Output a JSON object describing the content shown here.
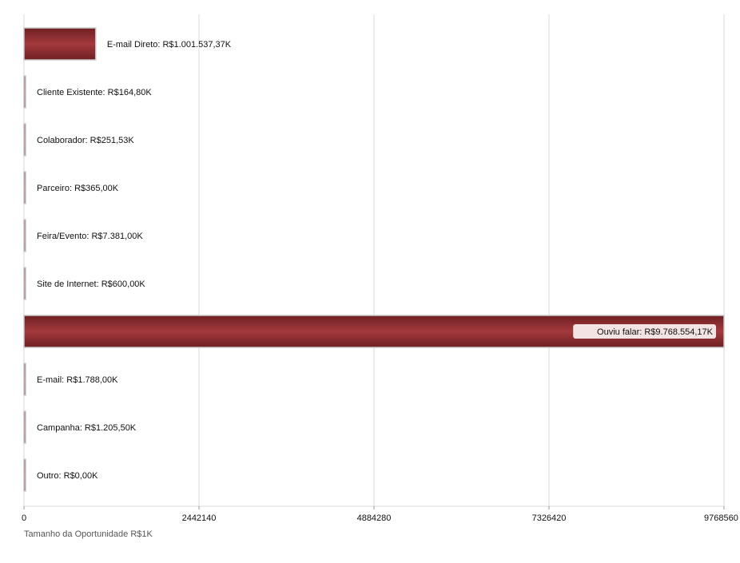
{
  "chart_data": {
    "type": "bar",
    "orientation": "horizontal",
    "categories": [
      "E-mail Direto",
      "Cliente Existente",
      "Colaborador",
      "Parceiro",
      "Feira/Evento",
      "Site de Internet",
      "Ouviu falar",
      "E-mail",
      "Campanha",
      "Outro"
    ],
    "values": [
      1001537.37,
      164.8,
      251.53,
      365.0,
      7381.0,
      600.0,
      9768554.17,
      1788.0,
      1205.5,
      0.0
    ],
    "data_labels": [
      "E-mail Direto: R$1.001.537,37K",
      "Cliente Existente: R$164,80K",
      "Colaborador: R$251,53K",
      "Parceiro: R$365,00K",
      "Feira/Evento: R$7.381,00K",
      "Site de Internet: R$600,00K",
      "Ouviu falar: R$9.768.554,17K",
      "E-mail: R$1.788,00K",
      "Campanha: R$1.205,50K",
      "Outro: R$0,00K"
    ],
    "xlim": [
      0,
      9768560
    ],
    "xticks": [
      0,
      2442140,
      4884280,
      7326420,
      9768560
    ],
    "xtick_labels": [
      "0",
      "2442140",
      "4884280",
      "7326420",
      "9768560"
    ],
    "xlabel": "Tamanho da Oportunidade R$1K",
    "ylabel": "",
    "title": "",
    "grid": true,
    "legend": "none",
    "colors": {
      "bar": "#8b2a2e",
      "bar_light": "#a3393d",
      "bar_dark": "#6e1f22",
      "bar_border": "#c9c9c9",
      "grid": "#d8d8d8",
      "text": "#111111",
      "axis_title": "#555555",
      "label_box": "#f3e3e3"
    }
  }
}
